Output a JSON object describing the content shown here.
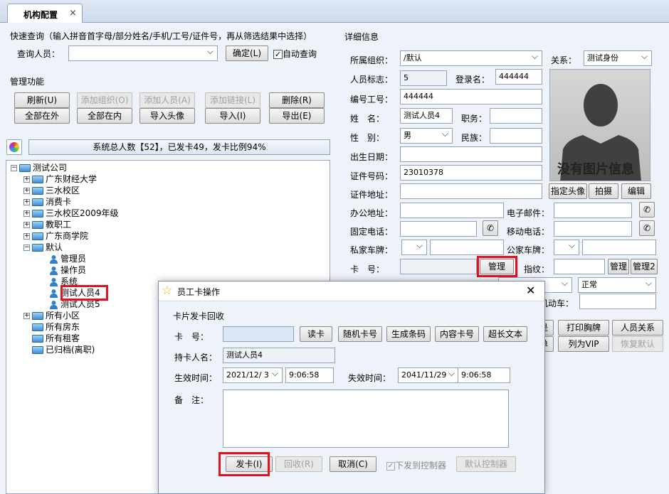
{
  "tab": {
    "title": "机构配置",
    "close": "×"
  },
  "quick": {
    "title": "快速查询（输入拼音首字母/部分姓名/手机/工号/证件号，再从筛选结果中选择）",
    "person_label": "查询人员：",
    "confirm": "确定(L)",
    "auto": "自动查询"
  },
  "mgmt": {
    "title": "管理功能",
    "buttons": [
      "刷新(U)",
      "添加组织(O)",
      "添加人员(A)",
      "添加链接(L)",
      "删除(R)",
      "全部在外",
      "全部在内",
      "导入头像",
      "导入(I)",
      "导出(E)"
    ]
  },
  "stats": "系统总人数【52】，已发卡49，发卡比例94%",
  "tree": {
    "root": "测试公司",
    "nodes": [
      "广东财经大学",
      "三水校区",
      "消费卡",
      "三水校区2009年级",
      "教职工",
      "广东商学院",
      "默认"
    ],
    "children": [
      "管理员",
      "操作员",
      "系统",
      "测试人员4",
      "测试人员5"
    ],
    "tail": [
      "所有小区",
      "所有房东",
      "所有租客",
      "已归档(离职)"
    ]
  },
  "detail": {
    "title": "详细信息",
    "org_label": "所属组织：",
    "org_value": "/默认",
    "relation_label": "关系：",
    "relation_value": "测试身份",
    "flag_label": "人员标志：",
    "flag_value": "5",
    "login_label": "登录名：",
    "login_value": "444444",
    "empno_label": "编号工号：",
    "empno_value": "444444",
    "name_label": "姓　名：",
    "name_value": "测试人员4",
    "job_label": "职务：",
    "gender_label": "性　别：",
    "gender_value": "男",
    "nation_label": "民族：",
    "birth_label": "出生日期：",
    "idno_label": "证件号码：",
    "idno_value": "23010378",
    "idaddr_label": "证件地址：",
    "office_label": "办公地址：",
    "email_label": "电子邮件：",
    "tel_label": "固定电话：",
    "mobile_label": "移动电话：",
    "pcar_label": "私家车牌：",
    "gcar_label": "公家车牌：",
    "card_label": "卡　号：",
    "manage": "管理",
    "finger_label": "指纹：",
    "manage1": "管理",
    "manage2": "管理2",
    "status_value": "正常",
    "vehicle_label": "机动车：",
    "photo_text": "没有图片信息",
    "photo_buttons": [
      "指定头像",
      "拍摄",
      "编辑"
    ],
    "action_buttons": [
      "打印胸牌",
      "人员关系",
      "列为VIP",
      "恢复默认"
    ],
    "partial1": "是",
    "partial2": "单"
  },
  "dialog": {
    "title": "员工卡操作",
    "group": "卡片发卡回收",
    "card_label": "卡　号：",
    "holder_label": "持卡人名：",
    "holder_value": "测试人员4",
    "eff_label": "生效时间：",
    "eff_date": "2021/12/ 3",
    "eff_time": "9:06:58",
    "exp_label": "失效时间：",
    "exp_date": "2041/11/29",
    "exp_time": "9:06:58",
    "note_label": "备　注：",
    "buttons": [
      "读卡",
      "随机卡号",
      "生成条码",
      "内容卡号",
      "超长文本"
    ],
    "issue": "发卡(I)",
    "recycle": "回收(R)",
    "cancel": "取消(C)",
    "send": "下发到控制器",
    "default_ctrl": "默认控制器"
  }
}
